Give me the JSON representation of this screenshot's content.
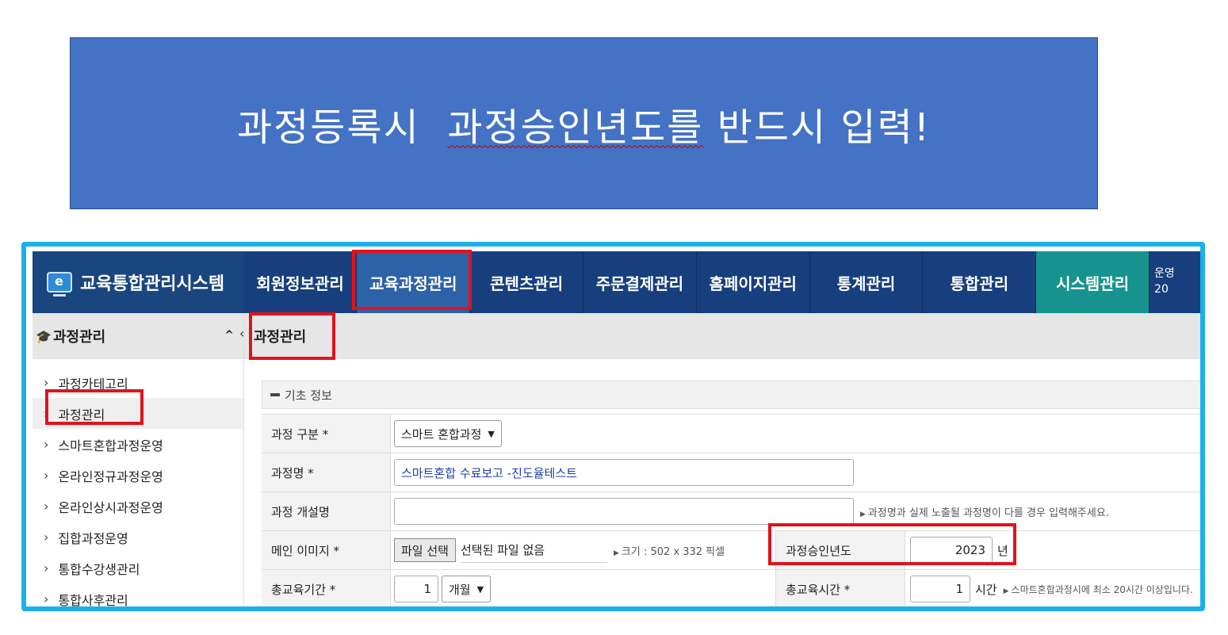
{
  "banner": {
    "part1": "과정등록시  ",
    "part2": "과정승인년도를",
    "part3": " 반드시 입력!"
  },
  "brand": {
    "title": "교육통합관리시스템",
    "icon": "monitor-e-icon"
  },
  "topnav": {
    "items": [
      "회원정보관리",
      "교육과정관리",
      "콘텐츠관리",
      "주문결제관리",
      "홈페이지관리",
      "통계관리",
      "통합관리",
      "시스템관리"
    ],
    "active_index": 1,
    "user_line1": "운영",
    "user_line2": "20"
  },
  "sidebar": {
    "header": "과정관리",
    "collapse_symbol": "^",
    "items": [
      "과정카테고리",
      "과정관리",
      "스마트혼합과정운영",
      "온라인정규과정운영",
      "온라인상시과정운영",
      "집합과정운영",
      "통합수강생관리",
      "통합사후관리"
    ],
    "selected_index": 1
  },
  "content": {
    "title": "과정관리",
    "section": "기초 정보",
    "fields": {
      "course_type_label": "과정 구분 *",
      "course_type_value": "스마트 혼합과정",
      "course_name_label": "과정명 *",
      "course_name_value": "스마트혼합 수료보고 -진도율테스트",
      "opening_name_label": "과정 개설명",
      "opening_name_value": "",
      "opening_name_hint": "과정명과 실제 노출될 과정명이 다를 경우 입력해주세요.",
      "main_image_label": "메인 이미지 *",
      "file_button": "파일 선택",
      "file_status": "선택된 파일 없음",
      "image_size_hint": "크기 : 502 x 332 픽셀",
      "approval_year_label": "과정승인년도",
      "approval_year_value": "2023",
      "approval_year_unit": "년",
      "total_period_label": "총교육기간 *",
      "total_period_value": "1",
      "total_period_unit": "개월",
      "total_hours_label": "총교육시간 *",
      "total_hours_value": "1",
      "total_hours_unit": "시간",
      "total_hours_hint": "스마트혼합과정시에 최소 20시간 이상입니다."
    }
  },
  "colors": {
    "banner": "#4472c4",
    "frame": "#1bb0ea",
    "nav": "#173f7d",
    "highlight": "#e0131b"
  }
}
